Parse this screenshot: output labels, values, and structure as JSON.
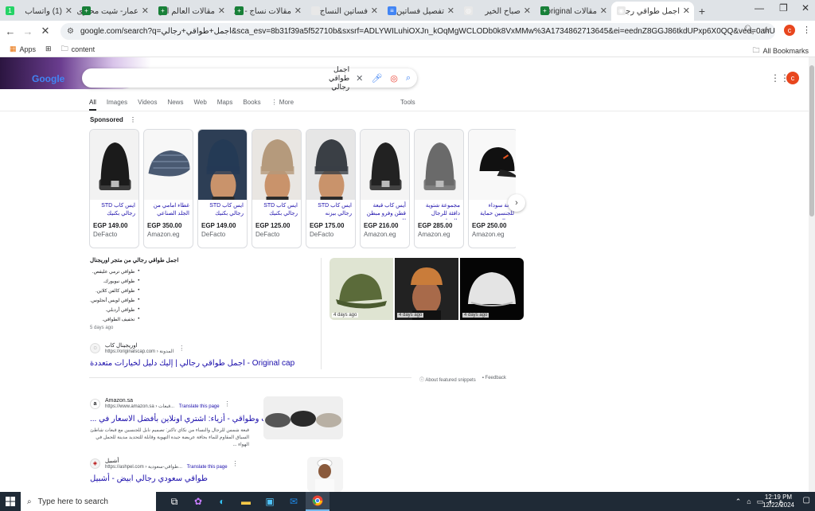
{
  "tabs": [
    {
      "label": "(1) واتساب",
      "color": "#25d366",
      "glyph": "1",
      "active": false
    },
    {
      "label": "عمار- شيت محتوى",
      "color": "#188038",
      "glyph": "+",
      "active": false
    },
    {
      "label": "مقالات العالم الر",
      "color": "#188038",
      "glyph": "+",
      "active": false
    },
    {
      "label": "مقالات نساج - 15",
      "color": "#188038",
      "glyph": "+",
      "active": false
    },
    {
      "label": "فساتين النساج",
      "color": "#e8e8e8",
      "glyph": "",
      "active": false
    },
    {
      "label": "تفصيل فساتين ا",
      "color": "#4285f4",
      "glyph": "≡",
      "active": false
    },
    {
      "label": "صباح الخير",
      "color": "#e8e8e8",
      "glyph": "◎",
      "active": false
    },
    {
      "label": "مقالات original",
      "color": "#188038",
      "glyph": "+",
      "active": false
    },
    {
      "label": "اجمل طواقي رجا",
      "color": "#e8e8e8",
      "glyph": "◉",
      "active": true
    }
  ],
  "toolbar": {
    "url": "google.com/search?q=اجمل+طواقي+رجالي&sca_esv=8b31f39a5f52710b&sxsrf=ADLYWILuhiOXJn_kOqMgWCLODb0k8VxMMw%3A1734862713645&ei=eednZ8GGJ86tkdUPxp6X0QQ&ved=0ahUKEwiBp5-ek7uKAxXOVq...",
    "profile_letter": "c"
  },
  "bookmarks": {
    "apps": "Apps",
    "folder": "content",
    "all": "All Bookmarks"
  },
  "search": {
    "query": "اجمل طواقي رجالي",
    "avatar_letter": "c",
    "logo_text": "Google"
  },
  "filters": [
    "All",
    "Images",
    "Videos",
    "News",
    "Web",
    "Maps",
    "Books",
    "⋮ More"
  ],
  "tools_label": "Tools",
  "sponsored_label": "Sponsored",
  "products": [
    {
      "name": "ايس كاب STD رجالي بكنيك",
      "price": "EGP 149.00",
      "store": "DeFacto",
      "hat": "#1b1b1b",
      "bg": "#f2f2f2",
      "type": "beanie"
    },
    {
      "name": "غطاء امامي من الجلد الصناعي بربيه ...",
      "price": "EGP 350.00",
      "store": "Amazon.eg",
      "hat": "#4a5a72",
      "bg": "#f7f7f7",
      "type": "flat"
    },
    {
      "name": "ايس كاب STD رجالي بكنيك",
      "price": "EGP 149.00",
      "store": "DeFacto",
      "hat": "#243a55",
      "bg": "#2d3e55",
      "type": "model"
    },
    {
      "name": "ايس كاب STD رجالي بكنيك",
      "price": "EGP 125.00",
      "store": "DeFacto",
      "hat": "#b59a7c",
      "bg": "#e9e6e2",
      "type": "model"
    },
    {
      "name": "ايس كاب STD رجالي بيزنه",
      "price": "EGP 175.00",
      "store": "DeFacto",
      "hat": "#3a3f45",
      "bg": "#e6e6e6",
      "type": "model"
    },
    {
      "name": "أيس كاب قبعة قطن وفرو مبطن للجنسين",
      "price": "EGP 216.00",
      "store": "Amazon.eg",
      "hat": "#222",
      "bg": "#f4f4f4",
      "type": "beanie"
    },
    {
      "name": "مجموعة شتوية دافئة للرجال والنساء من ...",
      "price": "EGP 285.00",
      "store": "Amazon.eg",
      "hat": "#6a6a6a",
      "bg": "#f4f4f4",
      "type": "beanie"
    },
    {
      "name": "قبعة سوداء للجنسين حماية من الشمس...",
      "price": "EGP 250.00",
      "store": "Amazon.eg",
      "hat": "#111",
      "bg": "#f8f8f8",
      "type": "cap"
    }
  ],
  "snippet": {
    "title": "اجمل طواقي رجالي من متجر اوريجنال",
    "items": [
      "طواقي ترمي عليقص.",
      "طواقي نيويورك.",
      "طواقي كالفن كلاين.",
      "طواقي لويس أنجلوس.",
      "طواقي أردبلي.",
      "تخفيف الطواقي."
    ],
    "date": "5 days ago",
    "images": [
      {
        "caption": "4 days ago",
        "bg": "#dfe4d2",
        "hat": "#5b6b3a"
      },
      {
        "caption": "4 days ago",
        "bg": "#222",
        "hat": "#c97c3a"
      },
      {
        "caption": "4 days ago",
        "bg": "#050505",
        "hat": "#e4e4e4"
      }
    ],
    "about": "About featured snippets",
    "feedback": "Feedback"
  },
  "results": [
    {
      "site": "اوريجينال كاب",
      "url": "https://originalscap.com › المدونة",
      "title": "Original cap - اجمل طواقي رجالي | إليك دليل لخيارات متعددة",
      "translate": "",
      "desc": ""
    },
    {
      "site": "Amazon.sa",
      "url": "https://www.amazon.sa › قبعات...",
      "title": "قبعات وطواقي - أزياء: اشتري اونلاين بأفضل الاسعار في ...",
      "translate": "Translate this page",
      "desc": "قبعة شمس للرجال والنساء من نكاي تاكنز: تصميم نابل للجنسين مع قبعات شاطئ السياق المقاوم للماء بحافة عريضة جيدة التهوية وقابلة للتحديد مدينة للحمل في الهواء ..."
    },
    {
      "site": "أشبيل",
      "url": "https://ashpel.com › طواقي-سعودية...",
      "title": "طواقي سعودي رجالي ابيض - أشبيل",
      "translate": "Translate this page",
      "desc": ""
    }
  ],
  "taskbar": {
    "search_placeholder": "Type here to search",
    "time": "12:19 PM",
    "date": "12/22/2024",
    "lang": "ع"
  }
}
